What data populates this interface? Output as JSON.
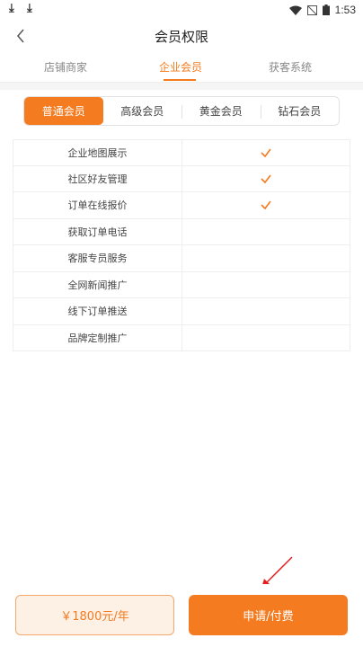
{
  "status_bar": {
    "time": "1:53",
    "icons": [
      "download-icon",
      "download-icon",
      "wifi-icon",
      "no-signal-icon",
      "battery-icon"
    ]
  },
  "nav": {
    "title": "会员权限",
    "back_icon": "chevron-left-icon"
  },
  "tabs": [
    {
      "label": "店铺商家",
      "active": false
    },
    {
      "label": "企业会员",
      "active": true
    },
    {
      "label": "获客系统",
      "active": false
    }
  ],
  "levels": [
    {
      "label": "普通会员",
      "active": true
    },
    {
      "label": "高级会员",
      "active": false
    },
    {
      "label": "黄金会员",
      "active": false
    },
    {
      "label": "钻石会员",
      "active": false
    }
  ],
  "benefits": [
    {
      "name": "企业地图展示",
      "included": true
    },
    {
      "name": "社区好友管理",
      "included": true
    },
    {
      "name": "订单在线报价",
      "included": true
    },
    {
      "name": "获取订单电话",
      "included": false
    },
    {
      "name": "客服专员服务",
      "included": false
    },
    {
      "name": "全网新闻推广",
      "included": false
    },
    {
      "name": "线下订单推送",
      "included": false
    },
    {
      "name": "品牌定制推广",
      "included": false
    }
  ],
  "footer": {
    "price": "￥1800元/年",
    "apply_label": "申请/付费"
  },
  "colors": {
    "accent": "#f47b20",
    "annotation_arrow": "#e02020"
  }
}
